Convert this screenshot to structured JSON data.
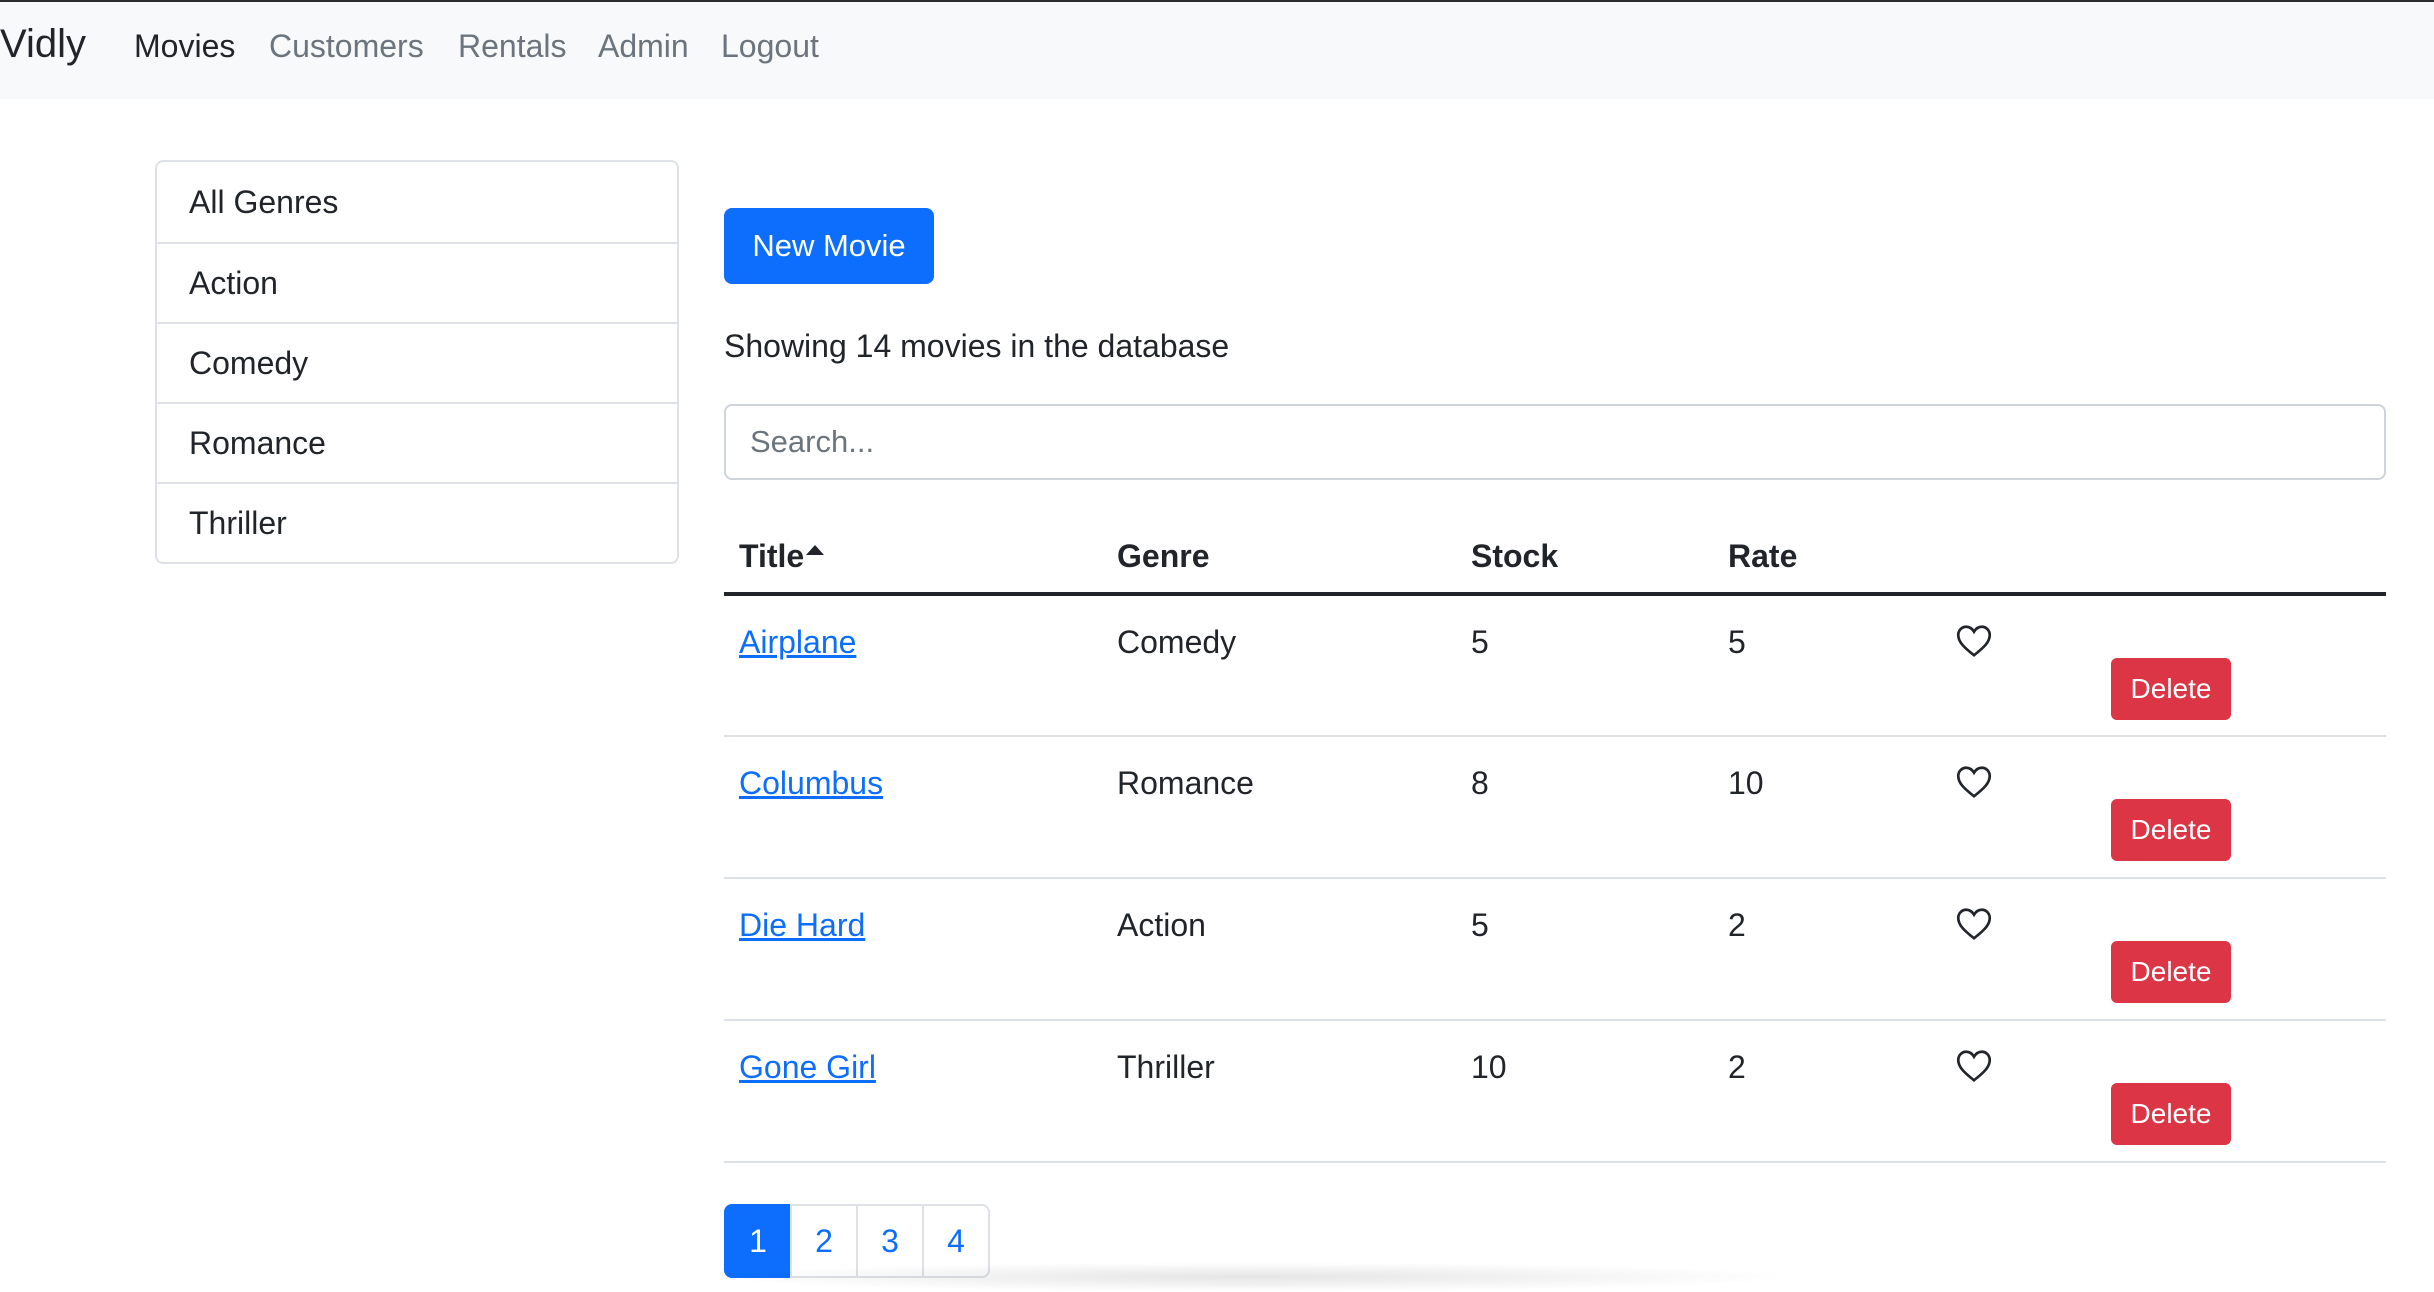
{
  "navbar": {
    "brand": "Vidly",
    "links": [
      "Movies",
      "Customers",
      "Rentals",
      "Admin",
      "Logout"
    ]
  },
  "genres": [
    "All Genres",
    "Action",
    "Comedy",
    "Romance",
    "Thriller"
  ],
  "main": {
    "new_button": "New Movie",
    "count_text": "Showing 14 movies in the database",
    "search_placeholder": "Search...",
    "columns": [
      "Title",
      "Genre",
      "Stock",
      "Rate"
    ],
    "delete_label": "Delete",
    "rows": [
      {
        "title": "Airplane",
        "genre": "Comedy",
        "stock": "5",
        "rate": "5"
      },
      {
        "title": "Columbus",
        "genre": "Romance",
        "stock": "8",
        "rate": "10"
      },
      {
        "title": "Die Hard",
        "genre": "Action",
        "stock": "5",
        "rate": "2"
      },
      {
        "title": "Gone Girl",
        "genre": "Thriller",
        "stock": "10",
        "rate": "2"
      }
    ]
  },
  "pagination": [
    "1",
    "2",
    "3",
    "4"
  ],
  "active_page": "1",
  "colors": {
    "primary": "#0d6efd",
    "danger": "#dc3545",
    "navbar_bg": "#f8f9fa"
  },
  "icons": {
    "like": "heart-outline-icon",
    "sort": "caret-up-icon"
  }
}
